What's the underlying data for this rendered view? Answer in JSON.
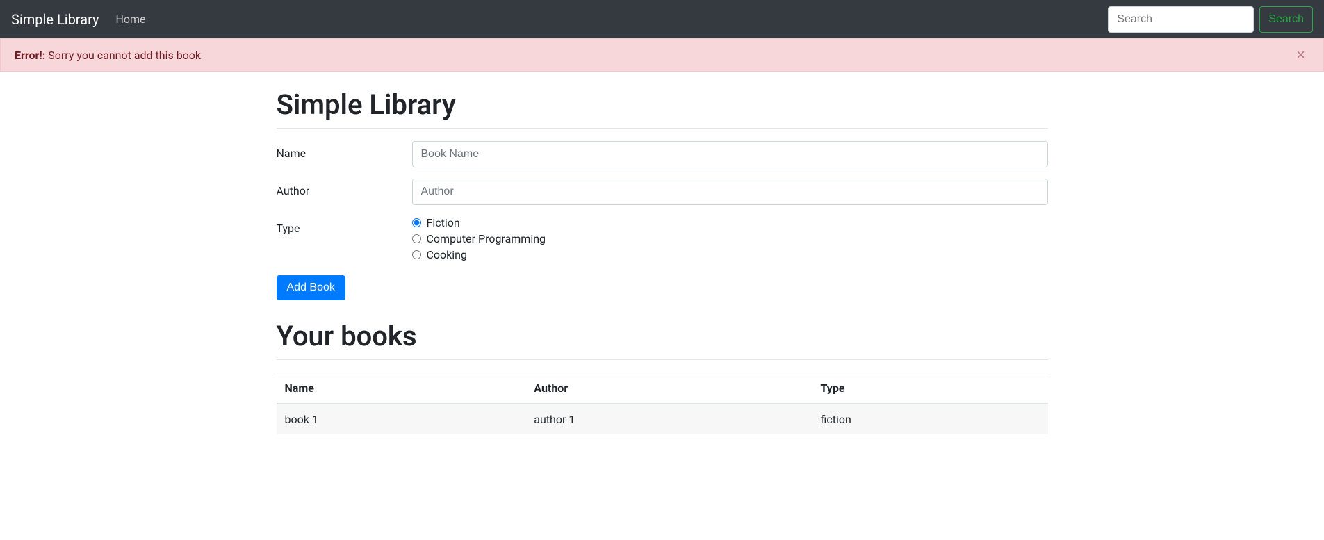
{
  "navbar": {
    "brand": "Simple Library",
    "home_label": "Home",
    "search_placeholder": "Search",
    "search_button": "Search"
  },
  "alert": {
    "strong": "Error!:",
    "message": "Sorry you cannot add this book"
  },
  "page": {
    "title": "Simple Library",
    "section_title": "Your books"
  },
  "form": {
    "name_label": "Name",
    "name_placeholder": "Book Name",
    "author_label": "Author",
    "author_placeholder": "Author",
    "type_label": "Type",
    "types": {
      "0": "Fiction",
      "1": "Computer Programming",
      "2": "Cooking"
    },
    "submit_label": "Add Book"
  },
  "table": {
    "headers": {
      "name": "Name",
      "author": "Author",
      "type": "Type"
    },
    "rows": {
      "0": {
        "name": "book 1",
        "author": "author 1",
        "type": "fiction"
      }
    }
  }
}
